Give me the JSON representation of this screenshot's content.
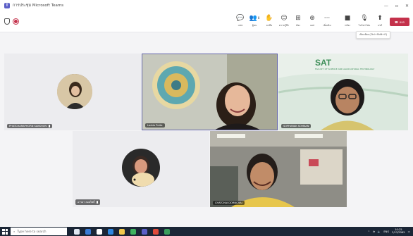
{
  "window": {
    "title": "การประชุม Microsoft Teams",
    "minimize": "—",
    "maximize": "▫",
    "close": "✕"
  },
  "toolbar": {
    "chat_label": "แชท",
    "people_label": "ผู้คน",
    "people_count": "8",
    "raise_label": "ยกมือ",
    "react_label": "ความรู้สึก",
    "rooms_label": "ห้อง",
    "apps_label": "แอป",
    "more_label": "เพิ่มเติม",
    "camera_label": "กล้อง",
    "mic_label": "ไมโครโฟน",
    "share_label": "แชร์",
    "leave_label": "ออก",
    "tooltip": "เปิดกล้อง (Ctrl+Shift+O)"
  },
  "participants": [
    {
      "name": "PHATCHARAPHORN SAKKHUN"
    },
    {
      "name": "Ladda Putta"
    },
    {
      "name": "SOPHARAK SOMKAN"
    },
    {
      "name": "อารยา ลอยโพธิ์"
    },
    {
      "name": "CHATCHAI DORNCHAI"
    }
  ],
  "banner": {
    "text": "SAT",
    "subtext": "FACULTY OF SCIENCE AND AGRICULTURAL TECHNOLOGY"
  },
  "taskbar": {
    "search_placeholder": "Type here to search",
    "time": "10:25",
    "date": "2/12/2565",
    "lang": "ENG"
  },
  "colors": {
    "accent": "#6264a7",
    "leave": "#c4314b",
    "taskbar": "#1b2636"
  }
}
